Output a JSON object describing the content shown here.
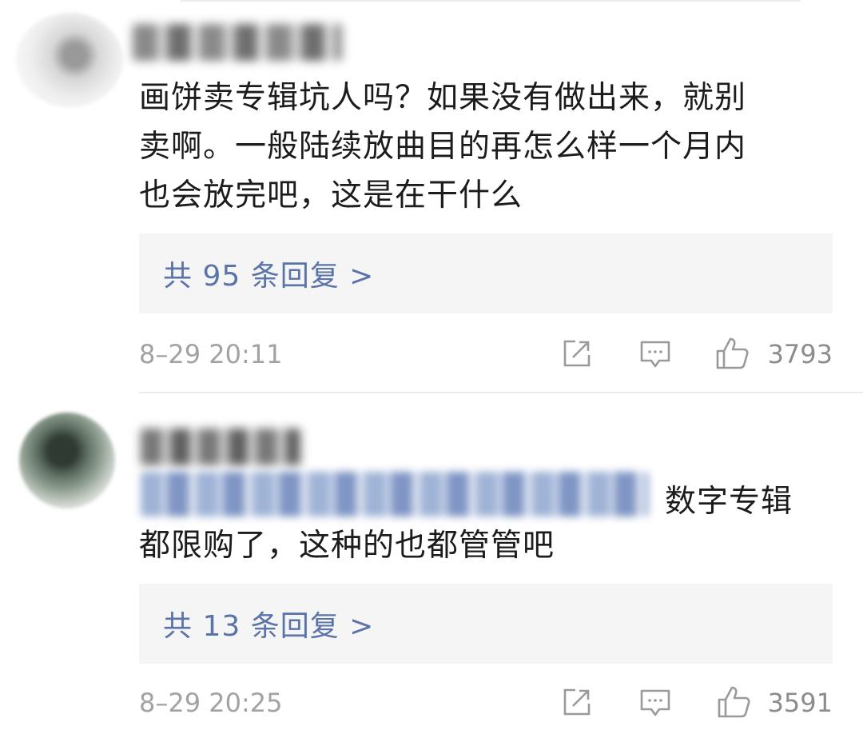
{
  "comments": [
    {
      "text_lines": [
        "画饼卖专辑坑人吗？如果没有做出来，就别",
        "卖啊。一般陆续放曲目的再怎么样一个月内",
        "也会放完吧，这是在干什么"
      ],
      "reply_label": "共 95 条回复 >",
      "timestamp": "8–29 20:11",
      "like_count": "3793"
    },
    {
      "mention_tail": "数字专辑",
      "text_lines": [
        "都限购了，这种的也都管管吧"
      ],
      "reply_label": "共 13 条回复 >",
      "timestamp": "8–29 20:25",
      "like_count": "3591"
    }
  ],
  "colors": {
    "reply_link": "#5a74a8",
    "reply_bg": "#f5f5f6",
    "meta_text": "#a2a2a2",
    "icon": "#9a9a9a"
  },
  "icons": [
    "share-icon",
    "comment-icon",
    "like-icon"
  ]
}
